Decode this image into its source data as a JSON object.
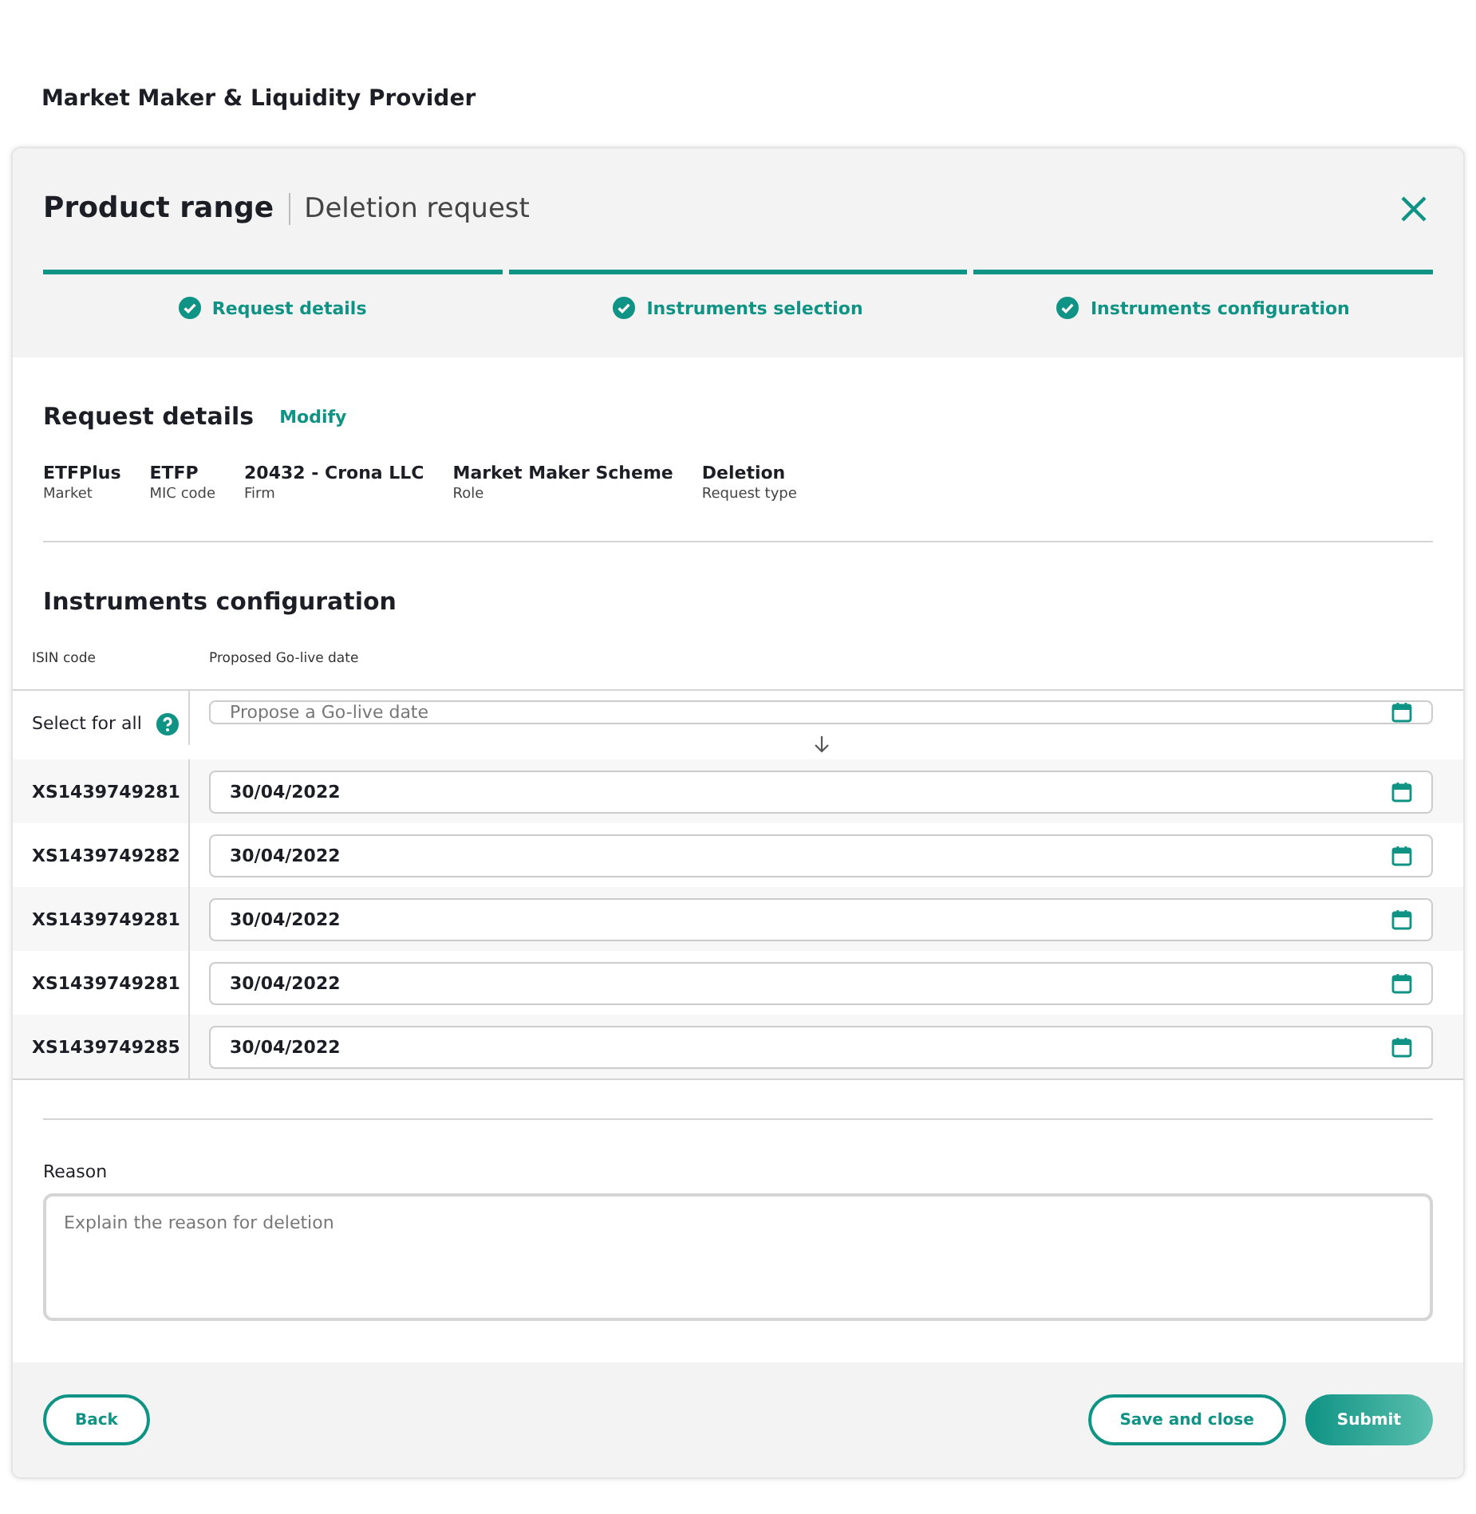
{
  "page_title": "Market Maker & Liquidity Provider",
  "dialog": {
    "title": "Product range",
    "subtitle": "Deletion request"
  },
  "steps": [
    {
      "label": "Request details",
      "completed": true
    },
    {
      "label": "Instruments selection",
      "completed": true
    },
    {
      "label": "Instruments configuration",
      "completed": true
    }
  ],
  "request_details": {
    "heading": "Request details",
    "modify_link": "Modify",
    "fields": [
      {
        "value": "ETFPlus",
        "label": "Market"
      },
      {
        "value": "ETFP",
        "label": "MIC code"
      },
      {
        "value": "20432 - Crona LLC",
        "label": "Firm"
      },
      {
        "value": "Market Maker Scheme",
        "label": "Role"
      },
      {
        "value": "Deletion",
        "label": "Request type"
      }
    ]
  },
  "instruments_configuration": {
    "heading": "Instruments configuration",
    "columns": [
      "ISIN code",
      "Proposed Go-live date"
    ],
    "select_for_all": {
      "label": "Select for all",
      "placeholder": "Propose a Go-live date"
    },
    "rows": [
      {
        "isin": "XS1439749281",
        "date": "30/04/2022"
      },
      {
        "isin": "XS1439749282",
        "date": "30/04/2022"
      },
      {
        "isin": "XS1439749281",
        "date": "30/04/2022"
      },
      {
        "isin": "XS1439749281",
        "date": "30/04/2022"
      },
      {
        "isin": "XS1439749285",
        "date": "30/04/2022"
      }
    ]
  },
  "reason": {
    "label": "Reason",
    "placeholder": "Explain the reason for deletion"
  },
  "buttons": {
    "back": "Back",
    "save": "Save and close",
    "submit": "Submit"
  }
}
